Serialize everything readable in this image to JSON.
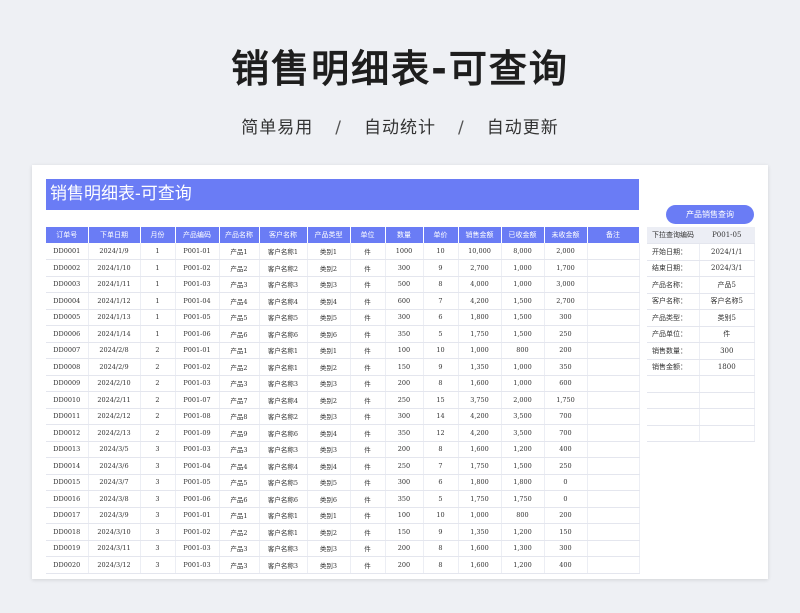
{
  "hero": {
    "title": "销售明细表-可查询",
    "features": [
      "简单易用",
      "自动统计",
      "自动更新"
    ],
    "separator": "/"
  },
  "sheet": {
    "banner": "销售明细表-可查询",
    "columns": [
      "订单号",
      "下单日期",
      "月份",
      "产品编码",
      "产品名称",
      "客户名称",
      "产品类型",
      "单位",
      "数量",
      "单价",
      "销售金额",
      "已收金额",
      "未收金额",
      "备注"
    ],
    "rows": [
      [
        "DD0001",
        "2024/1/9",
        "1",
        "P001-01",
        "产品1",
        "客户名称1",
        "类别1",
        "件",
        "1000",
        "10",
        "10,000",
        "8,000",
        "2,000",
        ""
      ],
      [
        "DD0002",
        "2024/1/10",
        "1",
        "P001-02",
        "产品2",
        "客户名称2",
        "类别2",
        "件",
        "300",
        "9",
        "2,700",
        "1,000",
        "1,700",
        ""
      ],
      [
        "DD0003",
        "2024/1/11",
        "1",
        "P001-03",
        "产品3",
        "客户名称3",
        "类别3",
        "件",
        "500",
        "8",
        "4,000",
        "1,000",
        "3,000",
        ""
      ],
      [
        "DD0004",
        "2024/1/12",
        "1",
        "P001-04",
        "产品4",
        "客户名称4",
        "类别4",
        "件",
        "600",
        "7",
        "4,200",
        "1,500",
        "2,700",
        ""
      ],
      [
        "DD0005",
        "2024/1/13",
        "1",
        "P001-05",
        "产品5",
        "客户名称5",
        "类别5",
        "件",
        "300",
        "6",
        "1,800",
        "1,500",
        "300",
        ""
      ],
      [
        "DD0006",
        "2024/1/14",
        "1",
        "P001-06",
        "产品6",
        "客户名称6",
        "类别6",
        "件",
        "350",
        "5",
        "1,750",
        "1,500",
        "250",
        ""
      ],
      [
        "DD0007",
        "2024/2/8",
        "2",
        "P001-01",
        "产品1",
        "客户名称1",
        "类别1",
        "件",
        "100",
        "10",
        "1,000",
        "800",
        "200",
        ""
      ],
      [
        "DD0008",
        "2024/2/9",
        "2",
        "P001-02",
        "产品2",
        "客户名称1",
        "类别2",
        "件",
        "150",
        "9",
        "1,350",
        "1,000",
        "350",
        ""
      ],
      [
        "DD0009",
        "2024/2/10",
        "2",
        "P001-03",
        "产品3",
        "客户名称3",
        "类别3",
        "件",
        "200",
        "8",
        "1,600",
        "1,000",
        "600",
        ""
      ],
      [
        "DD0010",
        "2024/2/11",
        "2",
        "P001-07",
        "产品7",
        "客户名称4",
        "类别2",
        "件",
        "250",
        "15",
        "3,750",
        "2,000",
        "1,750",
        ""
      ],
      [
        "DD0011",
        "2024/2/12",
        "2",
        "P001-08",
        "产品8",
        "客户名称2",
        "类别3",
        "件",
        "300",
        "14",
        "4,200",
        "3,500",
        "700",
        ""
      ],
      [
        "DD0012",
        "2024/2/13",
        "2",
        "P001-09",
        "产品9",
        "客户名称6",
        "类别4",
        "件",
        "350",
        "12",
        "4,200",
        "3,500",
        "700",
        ""
      ],
      [
        "DD0013",
        "2024/3/5",
        "3",
        "P001-03",
        "产品3",
        "客户名称3",
        "类别3",
        "件",
        "200",
        "8",
        "1,600",
        "1,200",
        "400",
        ""
      ],
      [
        "DD0014",
        "2024/3/6",
        "3",
        "P001-04",
        "产品4",
        "客户名称4",
        "类别4",
        "件",
        "250",
        "7",
        "1,750",
        "1,500",
        "250",
        ""
      ],
      [
        "DD0015",
        "2024/3/7",
        "3",
        "P001-05",
        "产品5",
        "客户名称5",
        "类别5",
        "件",
        "300",
        "6",
        "1,800",
        "1,800",
        "0",
        ""
      ],
      [
        "DD0016",
        "2024/3/8",
        "3",
        "P001-06",
        "产品6",
        "客户名称6",
        "类别6",
        "件",
        "350",
        "5",
        "1,750",
        "1,750",
        "0",
        ""
      ],
      [
        "DD0017",
        "2024/3/9",
        "3",
        "P001-01",
        "产品1",
        "客户名称1",
        "类别1",
        "件",
        "100",
        "10",
        "1,000",
        "800",
        "200",
        ""
      ],
      [
        "DD0018",
        "2024/3/10",
        "3",
        "P001-02",
        "产品2",
        "客户名称1",
        "类别2",
        "件",
        "150",
        "9",
        "1,350",
        "1,200",
        "150",
        ""
      ],
      [
        "DD0019",
        "2024/3/11",
        "3",
        "P001-03",
        "产品3",
        "客户名称3",
        "类别3",
        "件",
        "200",
        "8",
        "1,600",
        "1,300",
        "300",
        ""
      ],
      [
        "DD0020",
        "2024/3/12",
        "3",
        "P001-03",
        "产品3",
        "客户名称3",
        "类别3",
        "件",
        "200",
        "8",
        "1,600",
        "1,200",
        "400",
        ""
      ]
    ]
  },
  "query": {
    "button_label": "产品销售查询",
    "fields": [
      {
        "label": "下拉查询编码",
        "value": "P001-05"
      },
      {
        "label": "开始日期：",
        "value": "2024/1/1"
      },
      {
        "label": "结束日期：",
        "value": "2024/3/1"
      },
      {
        "label": "产品名称：",
        "value": "产品5"
      },
      {
        "label": "客户名称：",
        "value": "客户名称5"
      },
      {
        "label": "产品类型：",
        "value": "类别5"
      },
      {
        "label": "产品单位：",
        "value": "件"
      },
      {
        "label": "销售数量：",
        "value": "300"
      },
      {
        "label": "销售金额：",
        "value": "1800"
      }
    ],
    "empty_rows": 4
  }
}
